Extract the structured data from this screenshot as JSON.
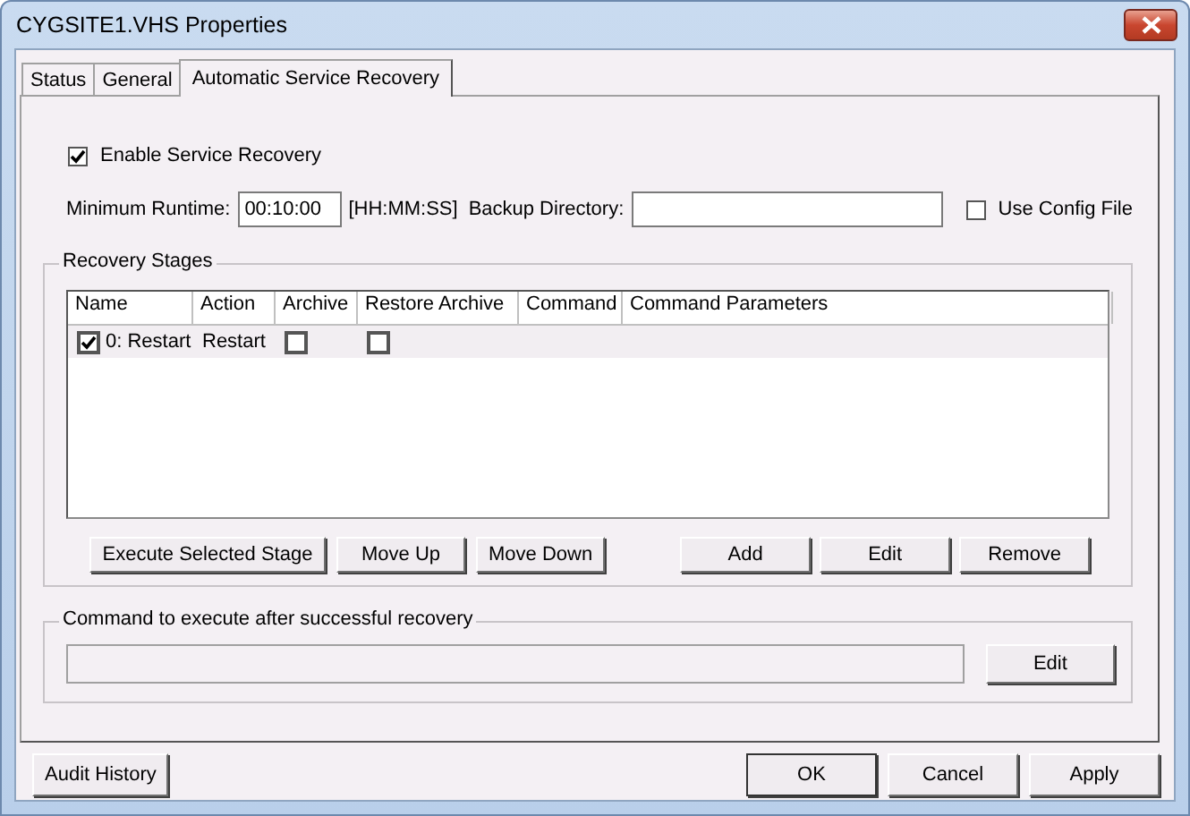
{
  "window": {
    "title": "CYGSITE1.VHS Properties"
  },
  "tabs": [
    {
      "label": "Status",
      "selected": false
    },
    {
      "label": "General",
      "selected": false
    },
    {
      "label": "Automatic Service Recovery",
      "selected": true
    }
  ],
  "enable_recovery": {
    "label": "Enable Service Recovery",
    "checked": true
  },
  "minimum_runtime": {
    "label": "Minimum Runtime:",
    "value": "00:10:00",
    "hint": "[HH:MM:SS]"
  },
  "backup_directory": {
    "label": "Backup Directory:"
  },
  "use_config_file": {
    "label": "Use Config File",
    "checked": false
  },
  "recovery_stages": {
    "title": "Recovery Stages",
    "columns": [
      "Name",
      "Action",
      "Archive",
      "Restore Archive",
      "Command",
      "Command Parameters"
    ],
    "rows": [
      {
        "checked": true,
        "name": "0: Restart",
        "action": "Restart",
        "archive": false,
        "restore_archive": false,
        "selected": true
      }
    ],
    "buttons_left": [
      "Execute Selected Stage",
      "Move Up",
      "Move Down"
    ],
    "buttons_right": [
      "Add",
      "Edit",
      "Remove"
    ]
  },
  "post_recovery": {
    "title": "Command to execute after successful recovery",
    "button": "Edit"
  },
  "footer": {
    "left_button": "Audit History",
    "buttons": [
      "OK",
      "Cancel",
      "Apply"
    ]
  }
}
